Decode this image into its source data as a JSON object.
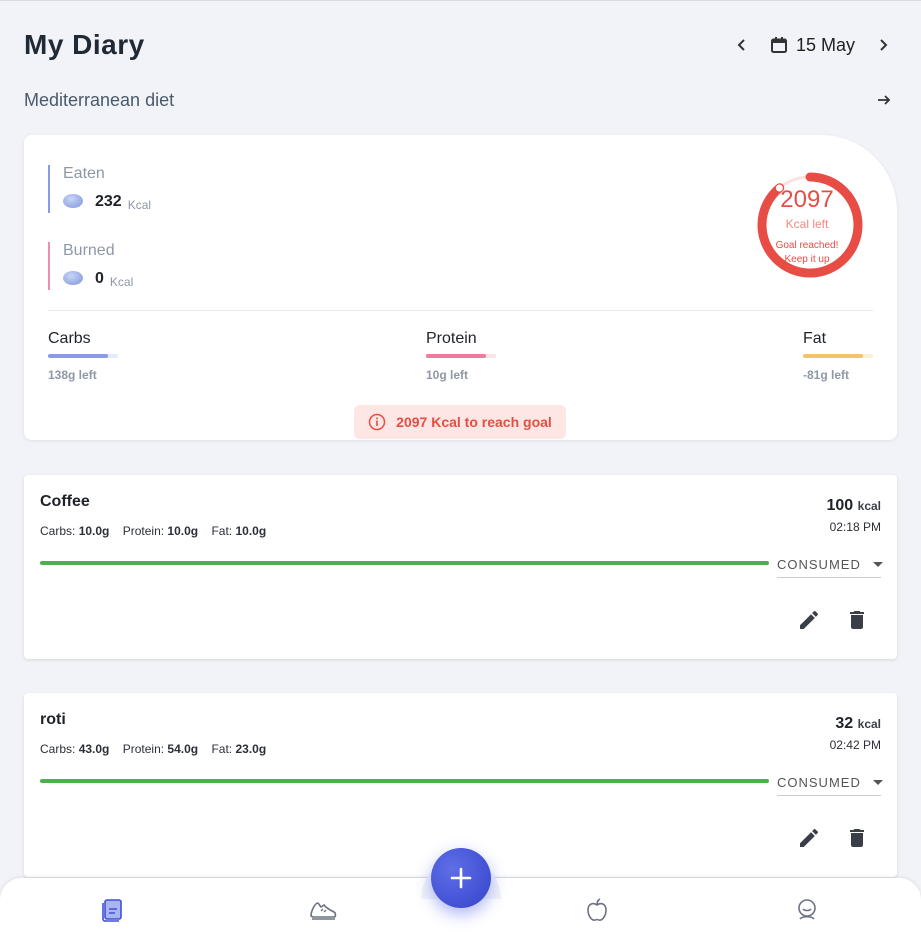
{
  "header": {
    "title": "My Diary",
    "date": "15 May"
  },
  "plan": {
    "name": "Mediterranean diet"
  },
  "summary": {
    "eaten": {
      "label": "Eaten",
      "value": "232",
      "unit": "Kcal"
    },
    "burned": {
      "label": "Burned",
      "value": "0",
      "unit": "Kcal"
    },
    "ring": {
      "value": "2097",
      "label": "Kcal left",
      "message_line1": "Goal reached!",
      "message_line2": "Keep it up",
      "progress": 0.89,
      "color": "#e74d45"
    },
    "macros": [
      {
        "name": "Carbs",
        "left": "138g left",
        "progress": 0.85,
        "color": "#8b9ae6",
        "track": "#e5e9fb"
      },
      {
        "name": "Protein",
        "left": "10g left",
        "progress": 0.85,
        "color": "#ee7b9c",
        "track": "#fbe3ea"
      },
      {
        "name": "Fat",
        "left": "-81g left",
        "progress": 0.85,
        "color": "#f1c46a",
        "track": "#fcefd6"
      }
    ],
    "goal_message": "2097 Kcal to reach goal"
  },
  "meals": [
    {
      "name": "Coffee",
      "carbs_label": "Carbs:",
      "carbs": "10.0g",
      "protein_label": "Protein:",
      "protein": "10.0g",
      "fat_label": "Fat:",
      "fat": "10.0g",
      "kcal": "100",
      "kcal_unit": "kcal",
      "time": "02:18 PM",
      "status": "CONSUMED",
      "progress": 1.0
    },
    {
      "name": "roti",
      "carbs_label": "Carbs:",
      "carbs": "43.0g",
      "protein_label": "Protein:",
      "protein": "54.0g",
      "fat_label": "Fat:",
      "fat": "23.0g",
      "kcal": "32",
      "kcal_unit": "kcal",
      "time": "02:42 PM",
      "status": "CONSUMED",
      "progress": 1.0
    }
  ],
  "nav": {
    "items": [
      "diary-icon",
      "activity-icon",
      "nutrition-icon",
      "profile-icon"
    ],
    "active_color": "#3f51d6",
    "inactive_color": "#6b7280"
  },
  "fab": {
    "icon": "plus-icon"
  }
}
